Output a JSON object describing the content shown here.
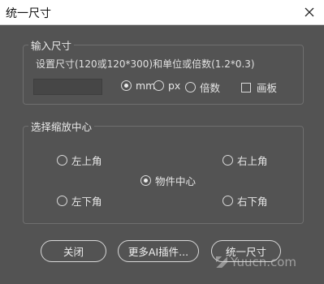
{
  "window": {
    "title": "统一尺寸"
  },
  "input_group": {
    "legend": "输入尺寸",
    "hint": "设置尺寸(120或120*300)和单位或倍数(1.2*0.3)",
    "size_value": "",
    "unit_options": [
      {
        "label": "mm",
        "selected": true
      },
      {
        "label": "px",
        "selected": false
      },
      {
        "label": "倍数",
        "selected": false
      }
    ],
    "artboard_label": "画板",
    "artboard_checked": false
  },
  "anchor_group": {
    "legend": "选择缩放中心",
    "top_left": "左上角",
    "top_right": "右上角",
    "center": "物件中心",
    "bottom_left": "左下角",
    "bottom_right": "右下角",
    "selected": "center"
  },
  "buttons": {
    "close": "关闭",
    "more_plugins": "更多AI插件...",
    "unify": "统一尺寸"
  },
  "watermark": "Yuucn.com"
}
